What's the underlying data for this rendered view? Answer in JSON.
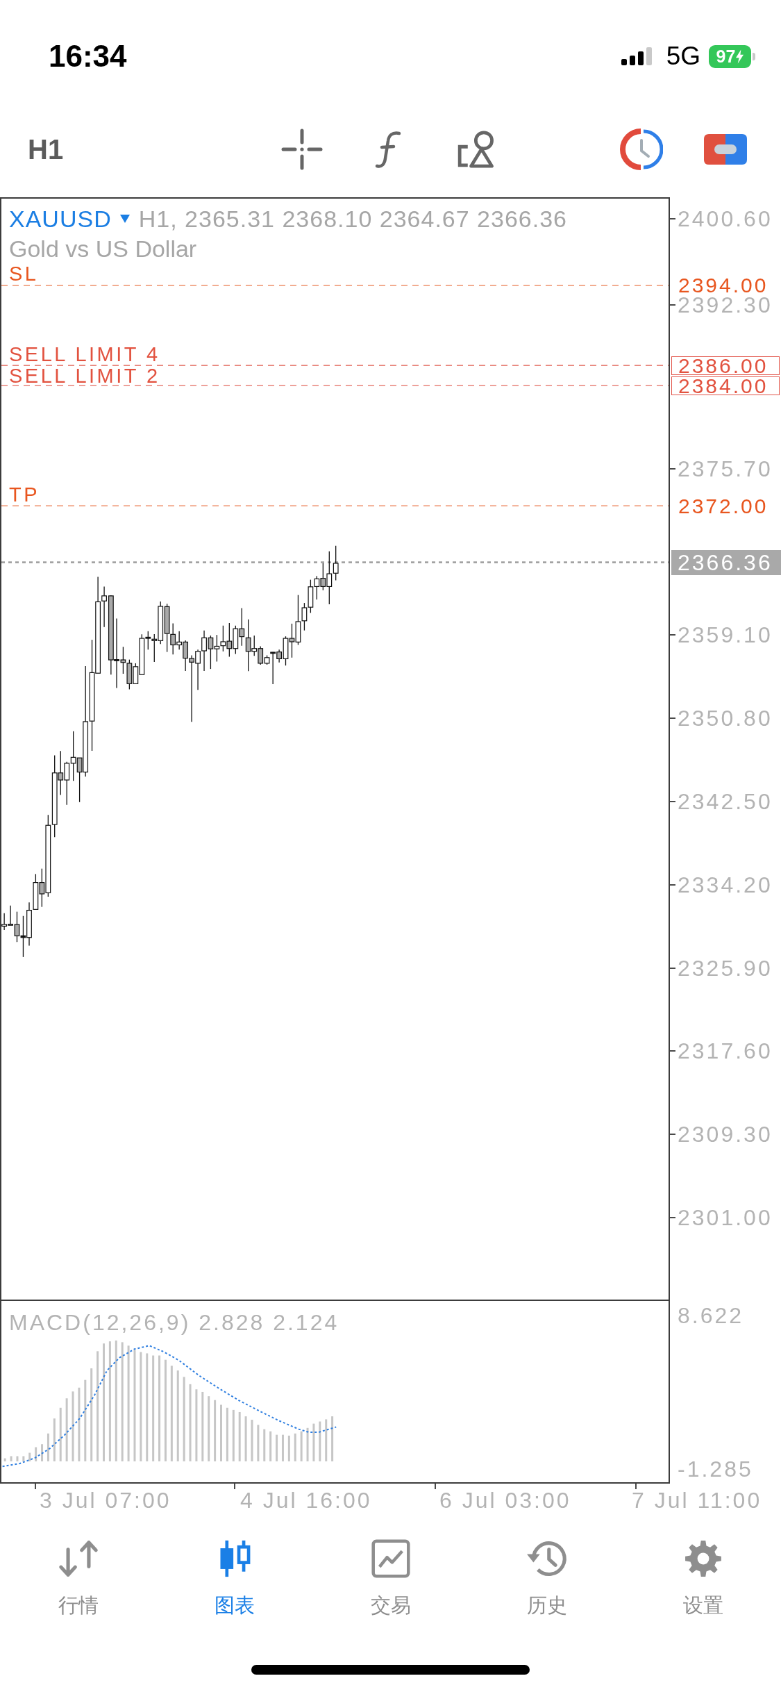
{
  "status_bar": {
    "time": "16:34",
    "network": "5G",
    "battery": "97"
  },
  "toolbar": {
    "timeframe": "H1"
  },
  "chart": {
    "symbol": "XAUUSD",
    "quote": "H1, 2365.31 2368.10 2364.67 2366.36",
    "description": "Gold vs US Dollar",
    "price_axis": [
      "2400.60",
      "2392.30",
      "2375.70",
      "2359.10",
      "2350.80",
      "2342.50",
      "2334.20",
      "2325.90",
      "2317.60",
      "2309.30",
      "2301.00"
    ],
    "orders": [
      {
        "kind": "sl",
        "label": "SL",
        "price": "2394.00"
      },
      {
        "kind": "limit",
        "label": "SELL LIMIT 4",
        "price": "2386.00"
      },
      {
        "kind": "limit",
        "label": "SELL LIMIT 2",
        "price": "2384.00"
      },
      {
        "kind": "tp",
        "label": "TP",
        "price": "2372.00"
      }
    ],
    "current_price": "2366.36"
  },
  "indicator": {
    "label": "MACD(12,26,9) 2.828 2.124",
    "scale": [
      "8.622",
      "-1.285"
    ]
  },
  "time_axis": [
    "3 Jul 07:00",
    "4 Jul 16:00",
    "6 Jul 03:00",
    "7 Jul 11:00"
  ],
  "tabs": [
    {
      "label": "行情",
      "selected": false
    },
    {
      "label": "图表",
      "selected": true
    },
    {
      "label": "交易",
      "selected": false
    },
    {
      "label": "历史",
      "selected": false
    },
    {
      "label": "设置",
      "selected": false
    }
  ]
}
